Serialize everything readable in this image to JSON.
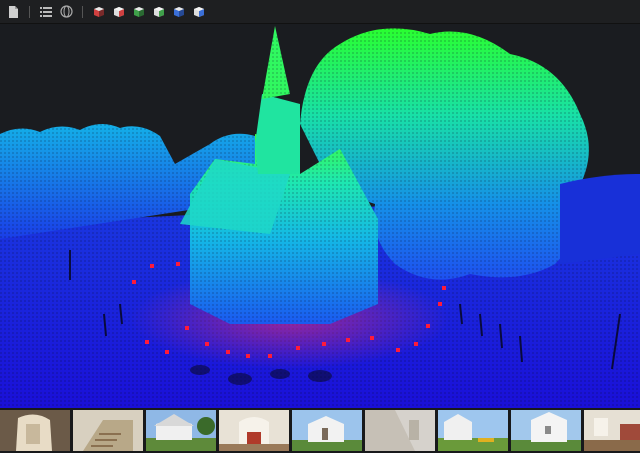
{
  "toolbar": {
    "tools": [
      {
        "icon": "document-icon"
      },
      {
        "icon": "list-icon"
      },
      {
        "icon": "orbit-icon"
      },
      {
        "icon": "view-cube-red-icon",
        "color": "#d04040"
      },
      {
        "icon": "view-cube-red-top-icon",
        "color": "#d04040"
      },
      {
        "icon": "view-cube-green-icon",
        "color": "#3fa04a"
      },
      {
        "icon": "view-cube-green-top-icon",
        "color": "#3fa04a"
      },
      {
        "icon": "view-cube-blue-icon",
        "color": "#3a6fd8"
      },
      {
        "icon": "view-cube-blue-top-icon",
        "color": "#3a6fd8"
      }
    ]
  },
  "viewport": {
    "content": "point-cloud",
    "colors": {
      "low": "#1a10e0",
      "mid": "#12a8e8",
      "high": "#3cff3c",
      "marker": "#ff2040"
    }
  },
  "filmstrip": {
    "thumbnails": [
      {
        "scene": "interior-doorway"
      },
      {
        "scene": "interior-stairs"
      },
      {
        "scene": "church-exterior"
      },
      {
        "scene": "church-interior-altar"
      },
      {
        "scene": "church-exterior"
      },
      {
        "scene": "interior-wall"
      },
      {
        "scene": "church-exterior-bench"
      },
      {
        "scene": "church-exterior"
      },
      {
        "scene": "interior-room"
      }
    ]
  }
}
